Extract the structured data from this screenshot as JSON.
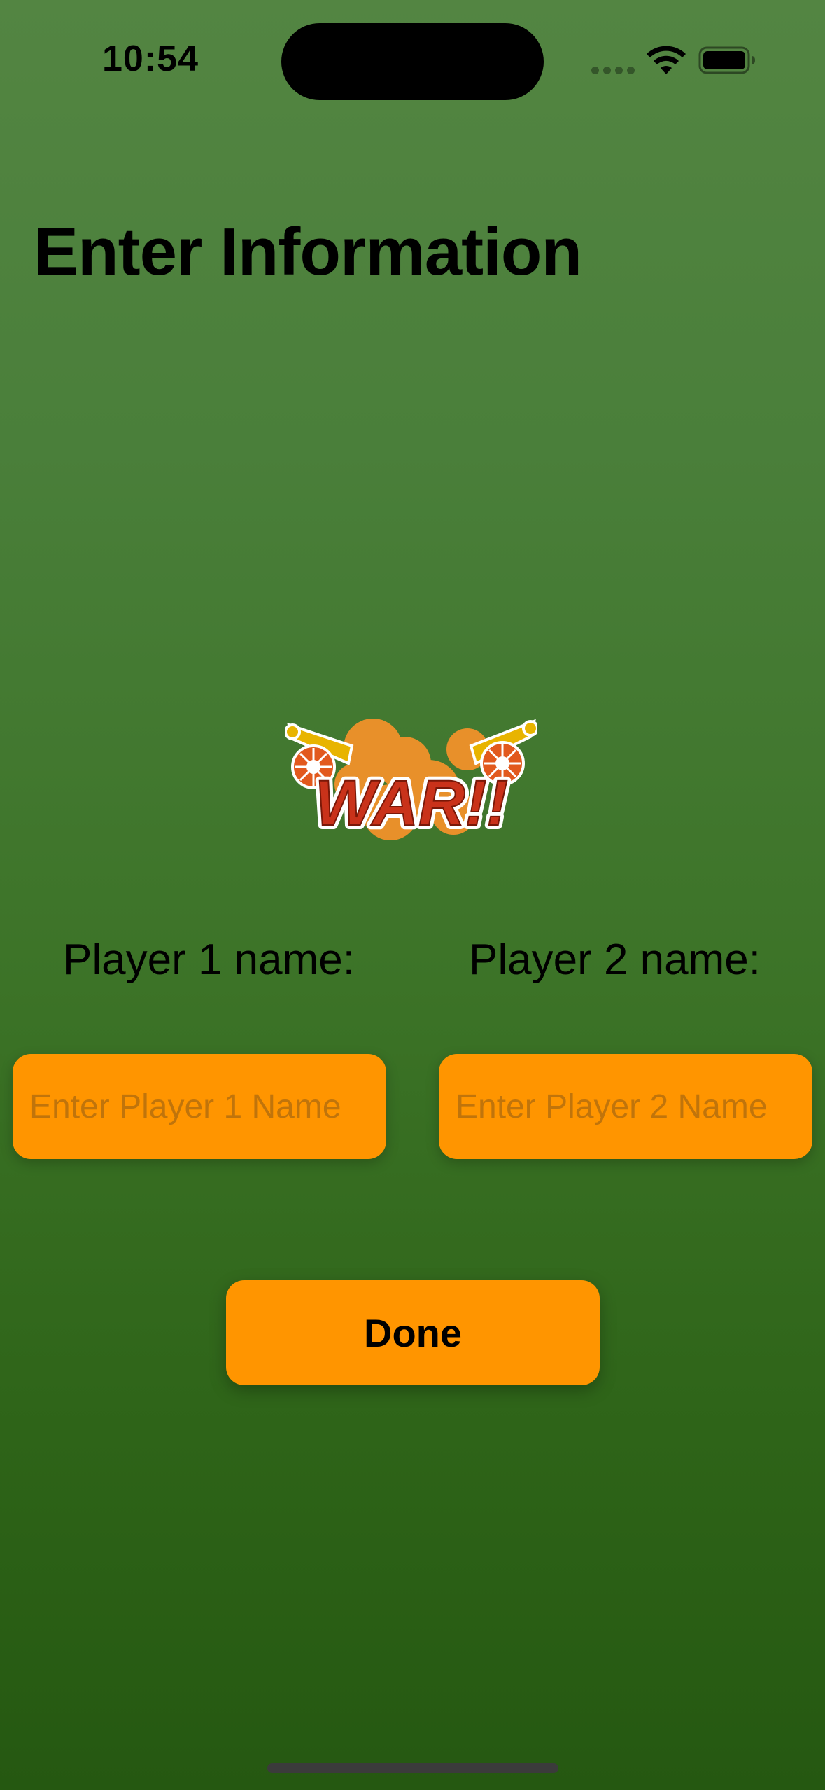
{
  "status_bar": {
    "time": "10:54",
    "wifi_icon": "wifi-icon",
    "battery_icon": "battery-icon",
    "signal_icon": "cellular-dots-icon"
  },
  "title": "Enter Information",
  "logo": {
    "text": "WAR!!",
    "icon": "cannons-war-logo"
  },
  "player1": {
    "label": "Player 1 name:",
    "placeholder": "Enter Player 1 Name",
    "value": ""
  },
  "player2": {
    "label": "Player 2 name:",
    "placeholder": "Enter Player 2 Name",
    "value": ""
  },
  "done_button": {
    "label": "Done"
  },
  "colors": {
    "background_top": "#538542",
    "background_bottom": "#255811",
    "accent": "#ff9500"
  }
}
